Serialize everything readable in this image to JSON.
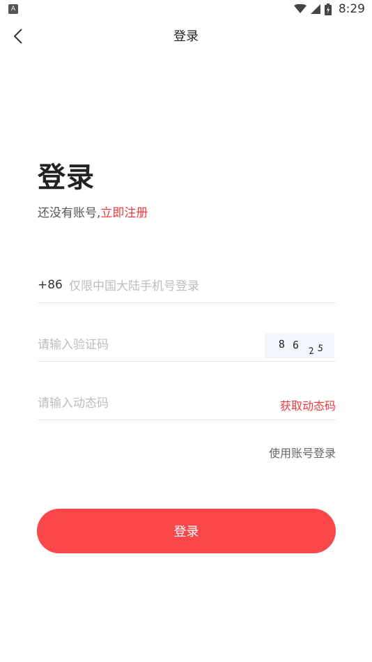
{
  "status_bar": {
    "left_icon_letter": "A",
    "time": "8:29",
    "icons": [
      "wifi-icon",
      "signal-icon",
      "battery-icon"
    ]
  },
  "nav": {
    "title": "登录",
    "back_icon": "chevron-left-icon"
  },
  "heading": "登录",
  "subtitle": {
    "prefix": "还没有账号,",
    "register_link": "立即注册"
  },
  "phone": {
    "prefix": "+86",
    "placeholder": "仅限中国大陆手机号登录",
    "value": ""
  },
  "captcha": {
    "placeholder": "请输入验证码",
    "value": "",
    "image_text": "8625"
  },
  "dynamic_code": {
    "placeholder": "请输入动态码",
    "value": "",
    "get_code_label": "获取动态码"
  },
  "account_login_label": "使用账号登录",
  "login_button_label": "登录",
  "colors": {
    "accent": "#f0393f",
    "button": "#f9474a",
    "text_primary": "#222222",
    "placeholder": "#bdbdbd"
  }
}
